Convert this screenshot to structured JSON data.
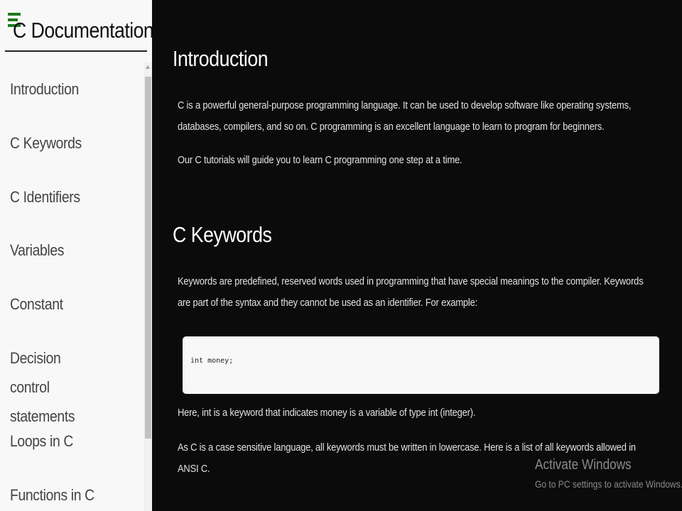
{
  "sidebar": {
    "title": "C Documentation",
    "menu_icon": "hamburger-menu-icon",
    "items": [
      {
        "label": "Introduction"
      },
      {
        "label": "C Keywords"
      },
      {
        "label": "C Identifiers"
      },
      {
        "label": "Variables"
      },
      {
        "label": "Constant"
      },
      {
        "label": "Decision control statements"
      },
      {
        "label": "Loops in C"
      },
      {
        "label": "Functions in C"
      }
    ]
  },
  "main": {
    "sections": [
      {
        "heading": "Introduction",
        "paragraphs": [
          "C is a powerful general-purpose programming language. It can be used to develop software like operating systems, databases, compilers, and so on. C programming is an excellent language to learn to program for beginners.",
          "Our C tutorials will guide you to learn C programming one step at a time."
        ]
      },
      {
        "heading": "C Keywords",
        "paragraphs": [
          "Keywords are predefined, reserved words used in programming that have special meanings to the compiler. Keywords are part of the syntax and they cannot be used as an identifier. For example:"
        ],
        "code": "int money;",
        "after_code": [
          "Here, int is a keyword that indicates money is a variable of type int (integer).",
          "As C is a case sensitive language, all keywords must be written in lowercase. Here is a list of all keywords allowed in ANSI C."
        ]
      }
    ]
  },
  "watermark": {
    "title": "Activate Windows",
    "subtitle": "Go to PC settings to activate Windows."
  },
  "colors": {
    "accent": "#1e7a1e",
    "sidebar_bg": "#f8f8f8",
    "main_bg": "#0b0b0b"
  }
}
